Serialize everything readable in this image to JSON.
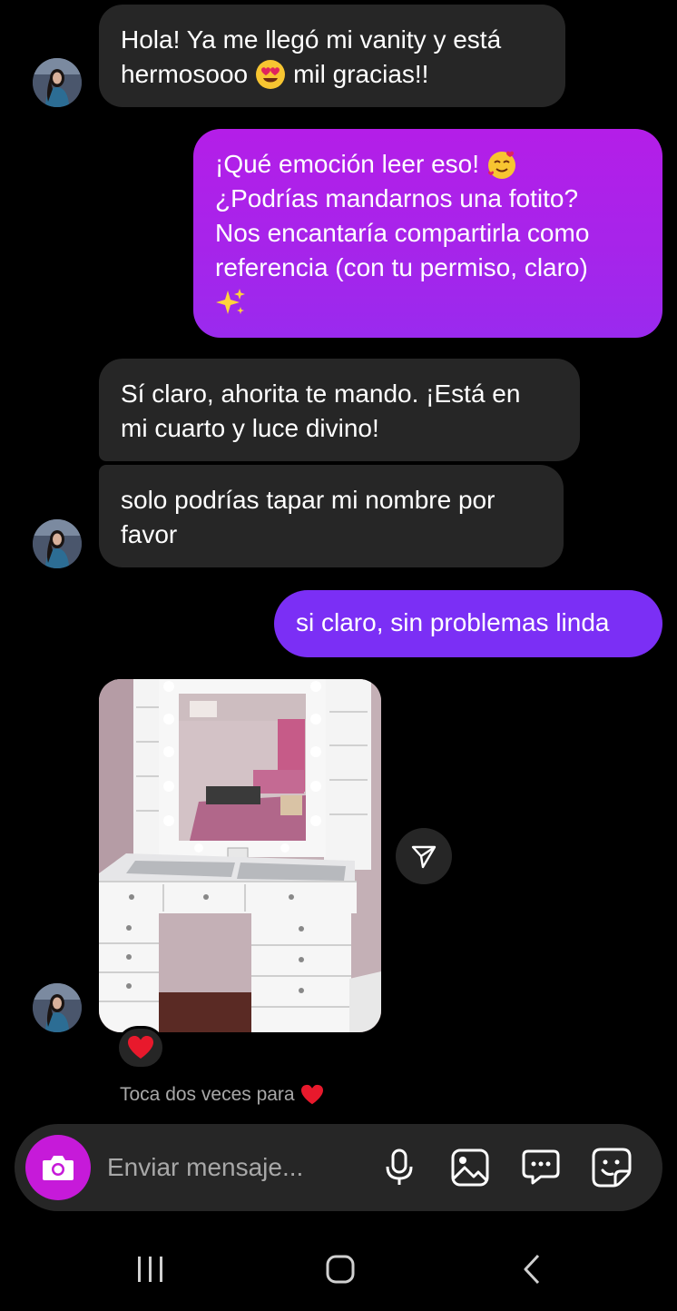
{
  "messages": {
    "msg1": {
      "line1": "Hola! Ya me llegó mi vanity y está",
      "line2a": "hermosooo",
      "line2b": "mil gracias!!"
    },
    "msg2": {
      "line1": "¡Qué emoción leer eso!",
      "line2": "¿Podrías mandarnos una fotito?",
      "line3": "Nos encantaría compartirla como",
      "line4": "referencia (con tu permiso, claro)"
    },
    "msg3": {
      "line1": "Sí claro, ahorita te mando. ¡Está en",
      "line2": "mi cuarto y luce divino!"
    },
    "msg4": {
      "line1": "solo podrías tapar mi nombre por",
      "line2": "favor"
    },
    "msg5": {
      "text": "si claro, sin problemas linda"
    }
  },
  "hint": {
    "text": "Toca dos veces para"
  },
  "composer": {
    "placeholder": "Enviar mensaje..."
  },
  "icons": {
    "avatar": "profile-avatar",
    "share": "send-arrow-icon",
    "reaction": "heart-emoji",
    "camera": "camera-icon",
    "mic": "microphone-icon",
    "gallery": "image-icon",
    "chat": "chat-bubble-icon",
    "sticker": "sticker-icon"
  },
  "colors": {
    "background": "#000000",
    "incoming_bubble": "#262626",
    "outgoing_gradient_top": "#b41ee8",
    "outgoing_solid": "#7b2ff5",
    "camera_button": "#c61ad9",
    "hint_text": "#a8a8a8"
  }
}
